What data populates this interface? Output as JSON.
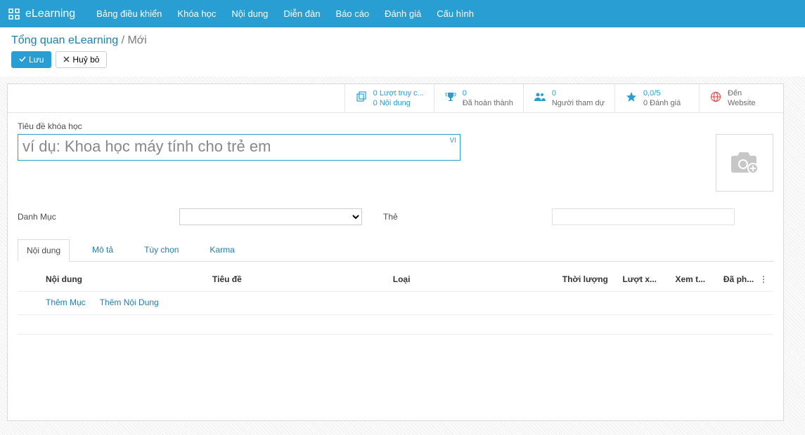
{
  "nav": {
    "brand": "eLearning",
    "items": [
      "Bảng điều khiển",
      "Khóa học",
      "Nội dung",
      "Diễn đàn",
      "Báo cáo",
      "Đánh giá",
      "Cấu hình"
    ]
  },
  "breadcrumb": {
    "root": "Tổng quan eLearning",
    "current": "Mới"
  },
  "actions": {
    "save": "Lưu",
    "discard": "Huỷ bỏ"
  },
  "stats": {
    "views_top": "0 Lượt truy c...",
    "views_bot": "0 Nội dung",
    "done_top": "0",
    "done_bot": "Đã hoàn thành",
    "attend_top": "0",
    "attend_bot": "Người tham dự",
    "rating_top": "0,0/5",
    "rating_bot": "0 Đánh giá",
    "site_top": "Đến",
    "site_bot": "Website"
  },
  "form": {
    "title_label": "Tiêu đề khóa học",
    "title_value": "",
    "title_placeholder": "ví dụ: Khoa học máy tính cho trẻ em",
    "lang_badge": "VI",
    "category_label": "Danh Mục",
    "tags_label": "Thẻ"
  },
  "tabs": [
    "Nội dung",
    "Mô tả",
    "Tùy chọn",
    "Karma"
  ],
  "active_tab": 0,
  "table": {
    "cols": [
      "Nội dung",
      "Tiêu đề",
      "Loại",
      "Thời lượng",
      "Lượt x...",
      "Xem t...",
      "Đã ph..."
    ]
  },
  "links": {
    "add_section": "Thêm Mục",
    "add_content": "Thêm Nội Dung"
  }
}
